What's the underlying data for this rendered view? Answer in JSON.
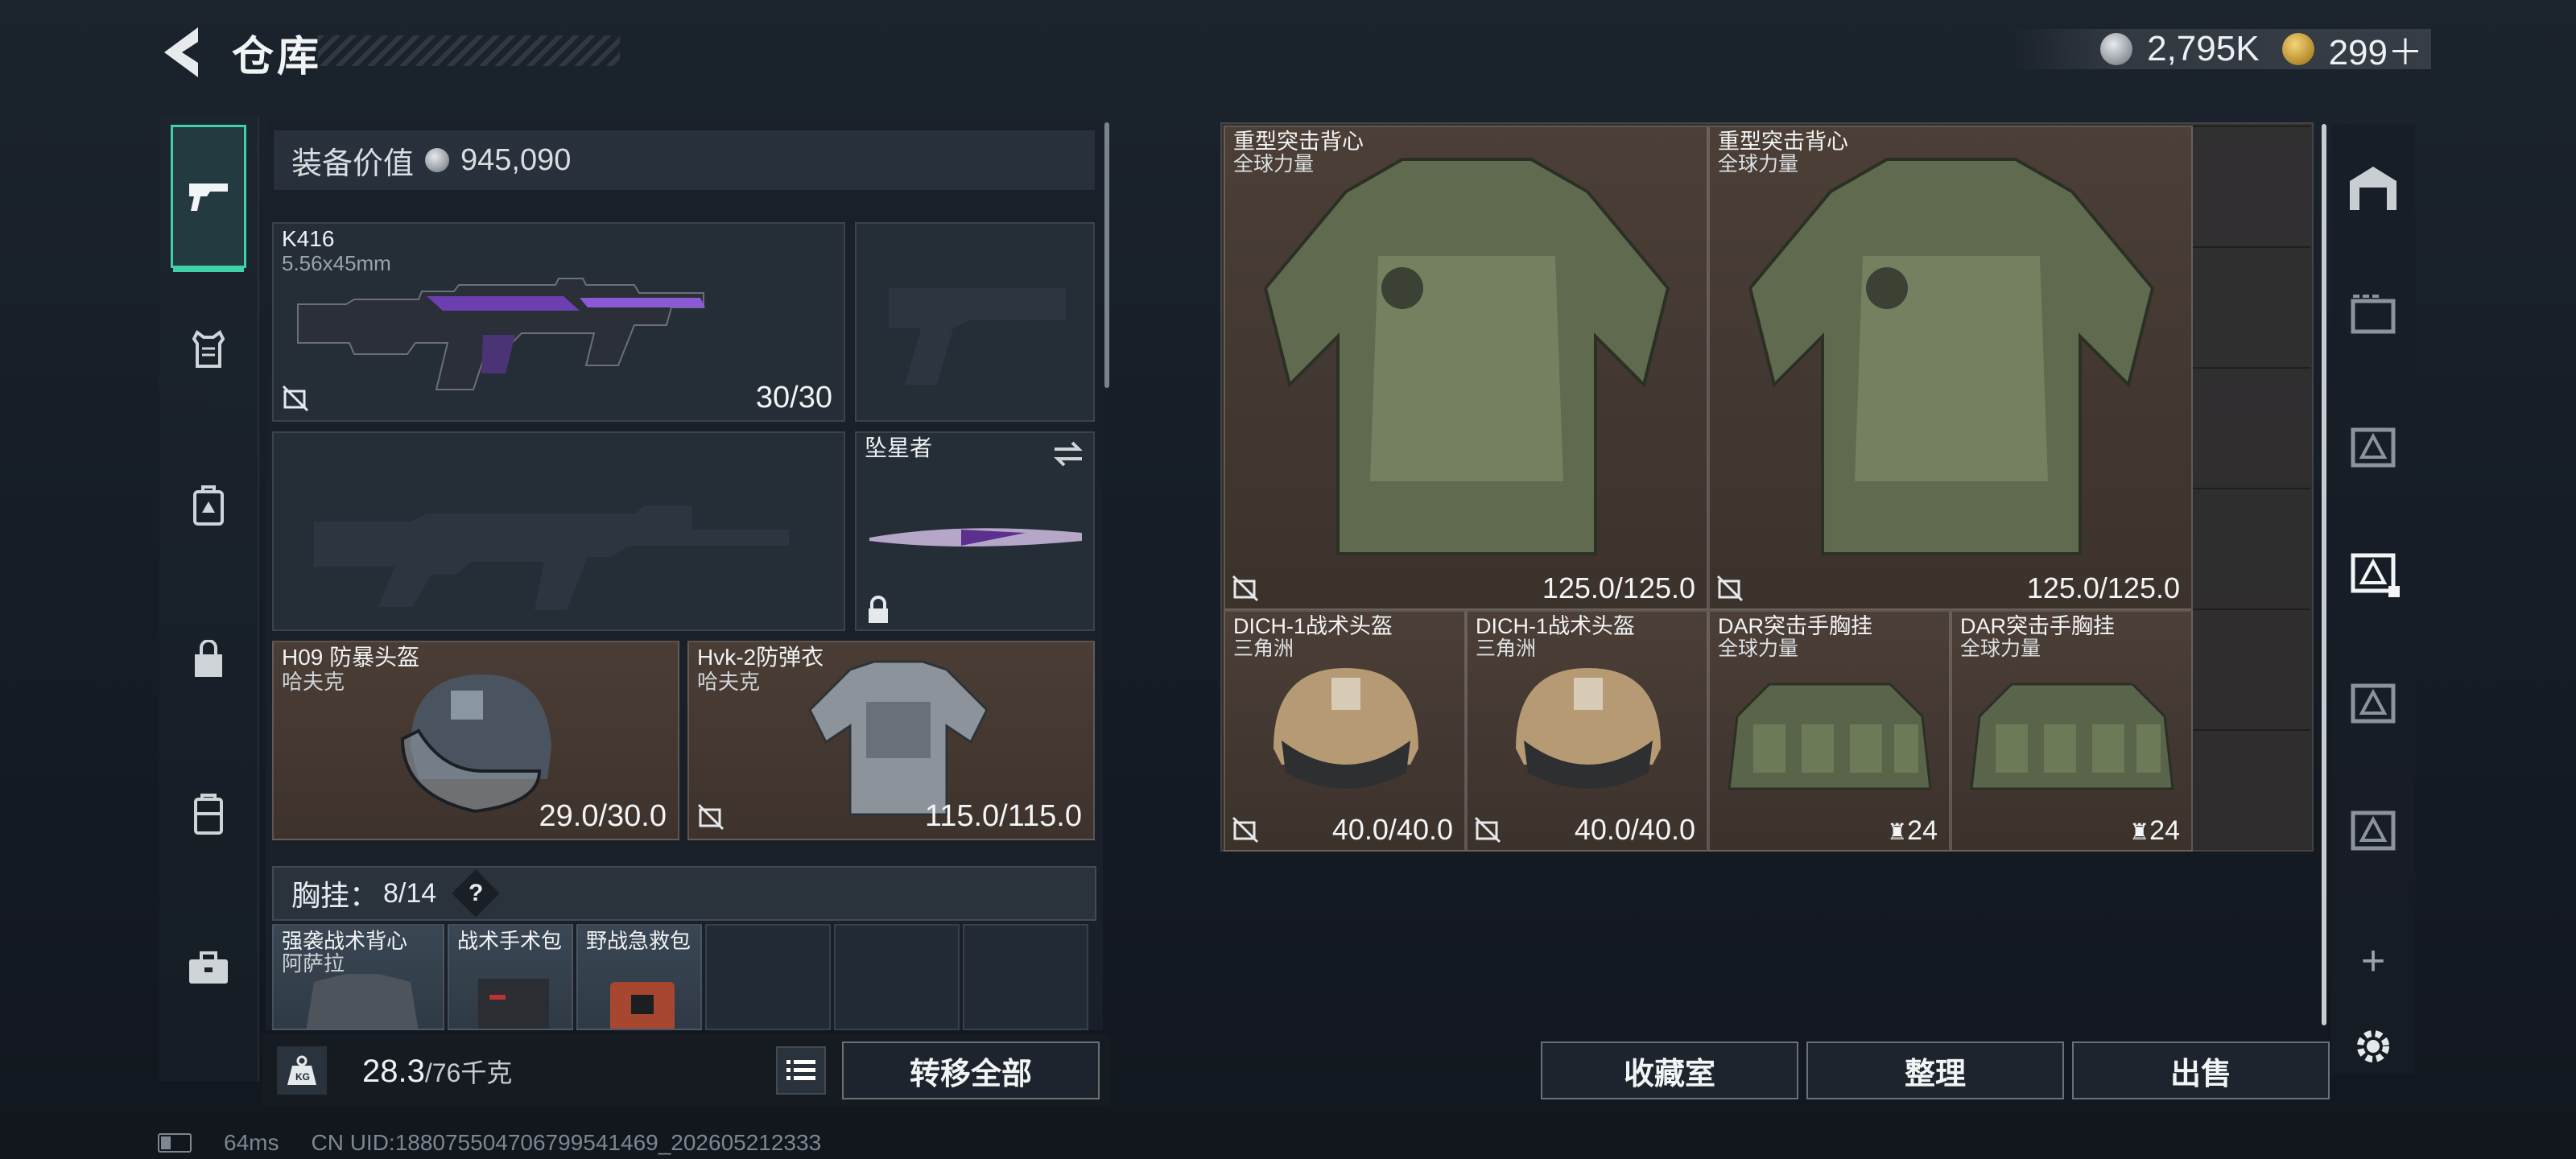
{
  "header": {
    "title": "仓库",
    "currency_silver": "2,795K",
    "currency_gold": "299＋"
  },
  "left_nav": {
    "items": [
      {
        "name": "weapons",
        "icon": "pistol-icon",
        "active": true
      },
      {
        "name": "armor",
        "icon": "vest-icon",
        "active": false
      },
      {
        "name": "backpack",
        "icon": "backpack-icon",
        "active": false
      },
      {
        "name": "bag",
        "icon": "bag-icon",
        "active": false
      },
      {
        "name": "case",
        "icon": "case-icon",
        "active": false
      },
      {
        "name": "toolbox",
        "icon": "toolbox-icon",
        "active": false
      }
    ]
  },
  "loadout": {
    "value_label": "装备价值",
    "value": "945,090",
    "primary": {
      "name": "K416",
      "caliber": "5.56x45mm",
      "ammo": "30/30"
    },
    "melee": {
      "name": "坠星者"
    },
    "helmet": {
      "name": "H09 防暴头盔",
      "maker": "哈夫克",
      "durability": "29.0/30.0"
    },
    "armor": {
      "name": "Hvk-2防弹衣",
      "maker": "哈夫克",
      "durability": "115.0/115.0"
    },
    "chest_rig": {
      "label": "胸挂：",
      "count": "8/14",
      "help": "?",
      "items": [
        {
          "name": "强袭战术背心",
          "maker": "阿萨拉"
        },
        {
          "name": "战术手术包",
          "maker": ""
        },
        {
          "name": "野战急救包",
          "maker": ""
        }
      ]
    },
    "weight": "28.3",
    "weight_max": "/76千克",
    "transfer_all": "转移全部"
  },
  "storage": {
    "items": [
      {
        "name": "重型突击背心",
        "maker": "全球力量",
        "value": "125.0/125.0"
      },
      {
        "name": "重型突击背心",
        "maker": "全球力量",
        "value": "125.0/125.0"
      },
      {
        "name": "DICH-1战术头盔",
        "maker": "三角洲",
        "value": "40.0/40.0"
      },
      {
        "name": "DICH-1战术头盔",
        "maker": "三角洲",
        "value": "40.0/40.0"
      },
      {
        "name": "DAR突击手胸挂",
        "maker": "全球力量",
        "value": "24"
      },
      {
        "name": "DAR突击手胸挂",
        "maker": "全球力量",
        "value": "24"
      }
    ],
    "buttons": {
      "collection": "收藏室",
      "organize": "整理",
      "sell": "出售"
    },
    "add": "+"
  },
  "footer": {
    "ping": "64ms",
    "uid": "CN UID:18807550470679954​1469_202605212333"
  },
  "colors": {
    "accent": "#3fd2a7",
    "slot_brown": "#463a33",
    "panel": "#1a212a"
  }
}
